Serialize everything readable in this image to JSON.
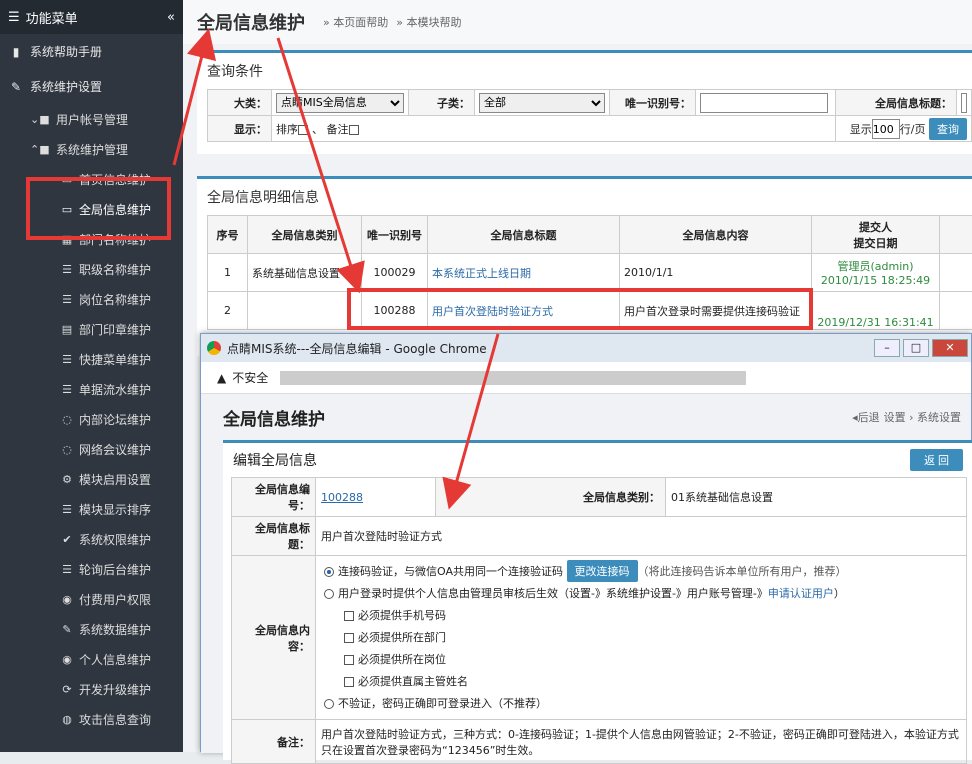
{
  "sidebar": {
    "title": "功能菜单",
    "top": [
      {
        "label": "系统帮助手册",
        "icon": "book-icon"
      },
      {
        "label": "系统维护设置",
        "icon": "wrench-icon"
      }
    ],
    "subs": [
      {
        "label": "用户帐号管理"
      },
      {
        "label": "系统维护管理"
      }
    ],
    "leaves": [
      {
        "label": "首页信息维护",
        "icon": "monitor-icon"
      },
      {
        "label": "全局信息维护",
        "icon": "monitor-icon"
      },
      {
        "label": "部门名称维护",
        "icon": "table-icon"
      },
      {
        "label": "职级名称维护",
        "icon": "list-icon"
      },
      {
        "label": "岗位名称维护",
        "icon": "list-icon"
      },
      {
        "label": "部门印章维护",
        "icon": "card-icon"
      },
      {
        "label": "快捷菜单维护",
        "icon": "list-icon"
      },
      {
        "label": "单据流水维护",
        "icon": "list-icon"
      },
      {
        "label": "内部论坛维护",
        "icon": "chat-icon"
      },
      {
        "label": "网络会议维护",
        "icon": "chat-icon"
      },
      {
        "label": "模块启用设置",
        "icon": "cog-icon"
      },
      {
        "label": "模块显示排序",
        "icon": "list-icon"
      },
      {
        "label": "系统权限维护",
        "icon": "check-icon"
      },
      {
        "label": "轮询后台维护",
        "icon": "list-icon"
      },
      {
        "label": "付费用户权限",
        "icon": "user-icon"
      },
      {
        "label": "系统数据维护",
        "icon": "wrench-icon"
      },
      {
        "label": "个人信息维护",
        "icon": "user-icon"
      },
      {
        "label": "开发升级维护",
        "icon": "refresh-icon"
      },
      {
        "label": "攻击信息查询",
        "icon": "globe-icon"
      }
    ]
  },
  "page": {
    "title": "全局信息维护",
    "help1": "» 本页面帮助",
    "help2": "» 本模块帮助"
  },
  "query": {
    "title": "查询条件",
    "l_cat": "大类：",
    "cat": "点睛MIS全局信息",
    "l_sub": "子类：",
    "sub": "全部",
    "l_id": "唯一识别号：",
    "l_t": "全局信息标题：",
    "l_show": "显示：",
    "sort": "排序",
    "note": "备注",
    "sep": "、",
    "show": "显示",
    "per": "100",
    "per_unit": "行/页",
    "search": "查询"
  },
  "detail": {
    "title": "全局信息明细信息",
    "headers": [
      "序号",
      "全局信息类别",
      "唯一识别号",
      "全局信息标题",
      "全局信息内容",
      "提交人\n提交日期"
    ],
    "rows": [
      {
        "no": "1",
        "cat": "系统基础信息设置",
        "id": "100029",
        "t": "本系统正式上线日期",
        "c": "2010/1/1",
        "by": "管理员(admin)",
        "date": "2010/1/15 18:25:49"
      },
      {
        "no": "2",
        "cat": "",
        "id": "100288",
        "t": "用户首次登陆时验证方式",
        "c": "用户首次登录时需要提供连接码验证",
        "by": "",
        "date": "2019/12/31 16:31:41"
      }
    ]
  },
  "win": {
    "title": "点睛MIS系统---全局信息编辑 - Google Chrome",
    "insecure": "不安全",
    "ptitle": "全局信息维护",
    "back": "后退",
    "crumb": "设置 › 系统设置",
    "edit_title": "编辑全局信息",
    "return": "返 回",
    "l_no": "全局信息编号：",
    "no": "100288",
    "l_cat": "全局信息类别：",
    "cat": "01系统基础信息设置",
    "l_t": "全局信息标题：",
    "t": "用户首次登陆时验证方式",
    "l_c": "全局信息内容：",
    "o1": "连接码验证，与微信OA共用同一个连接验证码",
    "o1btn": "更改连接码",
    "o1tip": "（将此连接码告诉本单位所有用户，推荐）",
    "o2": "用户登录时提供个人信息由管理员审核后生效（设置-》系统维护设置-》用户账号管理-》",
    "o2link": "申请认证用户",
    "o2end": "）",
    "c1": "必须提供手机号码",
    "c2": "必须提供所在部门",
    "c3": "必须提供所在岗位",
    "c4": "必须提供直属主管姓名",
    "o3": "不验证，密码正确即可登录进入（不推荐）",
    "l_note": "备注：",
    "note": "用户首次登陆时验证方式，三种方式：0-连接码验证；1-提供个人信息由网管验证；2-不验证，密码正确即可登陆进入，本验证方式只在设置首次登录密码为“123456”时生效。"
  }
}
